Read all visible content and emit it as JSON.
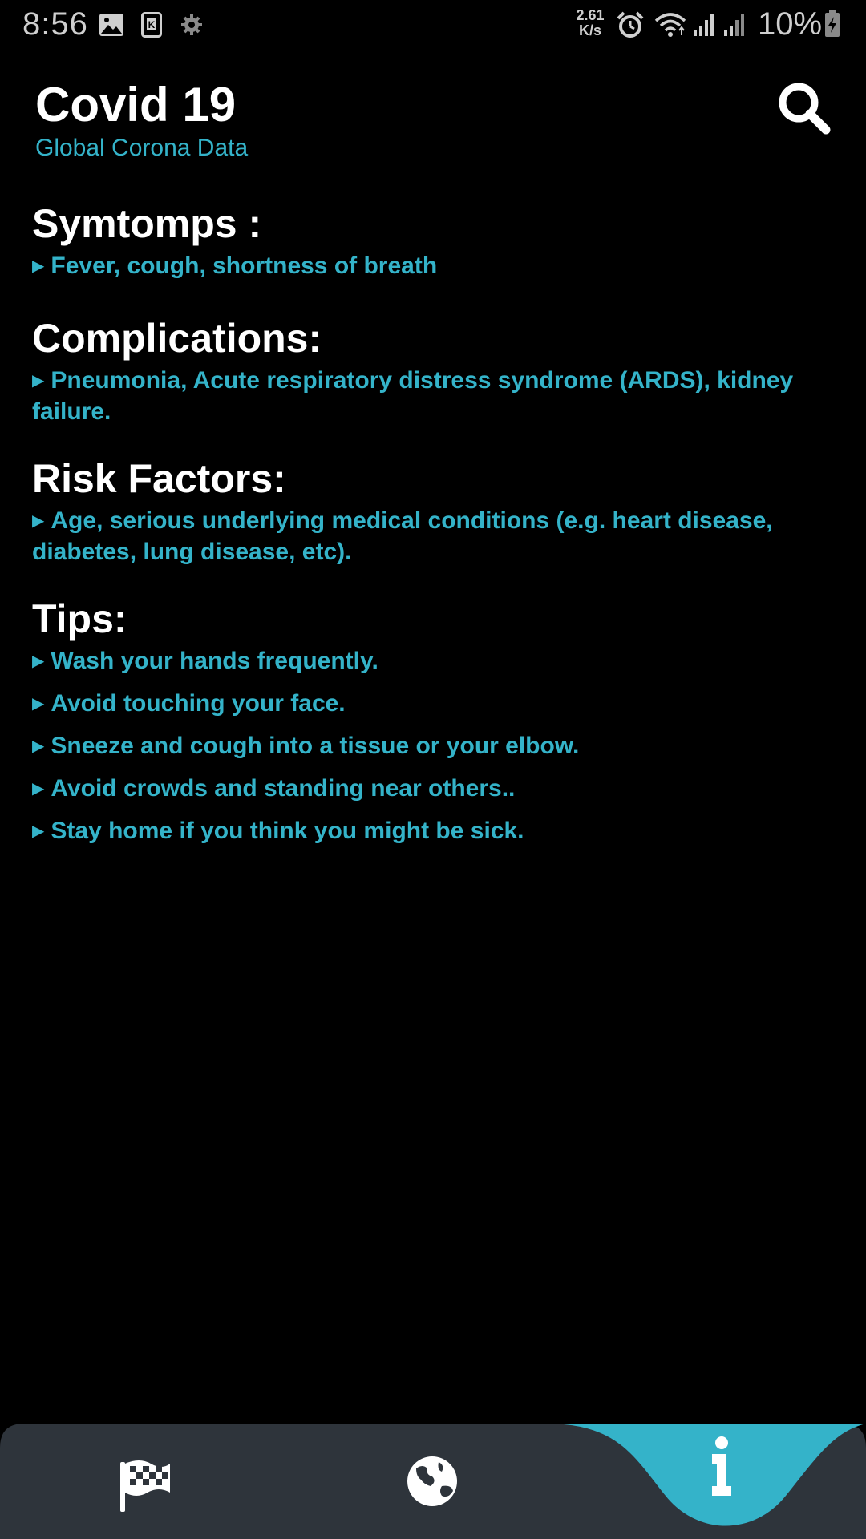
{
  "status_bar": {
    "time": "8:56",
    "net_speed_value": "2.61",
    "net_speed_unit": "K/s",
    "battery": "10%",
    "icons": [
      "gallery-icon",
      "k-notification-icon",
      "settings-gear-icon",
      "alarm-icon",
      "wifi-icon",
      "signal-icon",
      "signal-icon",
      "battery-charging-icon"
    ]
  },
  "header": {
    "title": "Covid 19",
    "subtitle": "Global Corona Data",
    "search_icon": "search-icon"
  },
  "sections": {
    "symptoms": {
      "title": "Symtomps :",
      "items": [
        "Fever, cough, shortness of breath"
      ]
    },
    "complications": {
      "title": "Complications:",
      "items": [
        "Pneumonia, Acute respiratory distress syndrome (ARDS), kidney failure."
      ]
    },
    "risk_factors": {
      "title": "Risk Factors:",
      "items": [
        "Age, serious underlying medical conditions (e.g. heart disease, diabetes, lung disease, etc)."
      ]
    },
    "tips": {
      "title": "Tips:",
      "items": [
        "Wash your hands frequently.",
        "Avoid touching your face.",
        "Sneeze and cough into a tissue or your elbow.",
        "Avoid crowds and standing near others..",
        "Stay home if you think you might be sick."
      ]
    }
  },
  "bullet_glyph": "▶",
  "bottom_nav": {
    "items": [
      {
        "icon": "checkered-flag-icon"
      },
      {
        "icon": "globe-icon"
      },
      {
        "icon": "info-icon",
        "active": true
      }
    ]
  },
  "colors": {
    "background": "#000000",
    "accent": "#34b3c9",
    "nav_background": "#2e343b",
    "text_primary": "#ffffff"
  }
}
